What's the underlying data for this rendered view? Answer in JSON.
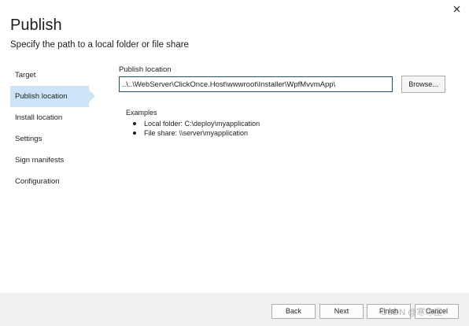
{
  "dialog": {
    "title": "Publish",
    "subtitle": "Specify the path to a local folder or file share",
    "close_icon": "close-icon"
  },
  "nav": {
    "items": [
      {
        "label": "Target",
        "active": false
      },
      {
        "label": "Publish location",
        "active": true
      },
      {
        "label": "Install location",
        "active": false
      },
      {
        "label": "Settings",
        "active": false
      },
      {
        "label": "Sign manifests",
        "active": false
      },
      {
        "label": "Configuration",
        "active": false
      }
    ]
  },
  "publish_location": {
    "label": "Publish location",
    "value": "..\\..\\WebServer\\ClickOnce.Host\\wwwroot\\Installer\\WpfMvvmApp\\",
    "browse_label": "Browse..."
  },
  "examples": {
    "heading": "Examples",
    "items": [
      "Local folder:  C:\\deploy\\myapplication",
      "File share: \\\\server\\myapplication"
    ]
  },
  "footer": {
    "back_label": "Back",
    "next_label": "Next",
    "finish_label": "Finish",
    "cancel_label": "Cancel",
    "watermark": "CSDN @寒冰屋"
  },
  "colors": {
    "active_nav": "#cce4f7",
    "input_border": "#1f4e79",
    "footer_bg": "#f0f0f0"
  }
}
